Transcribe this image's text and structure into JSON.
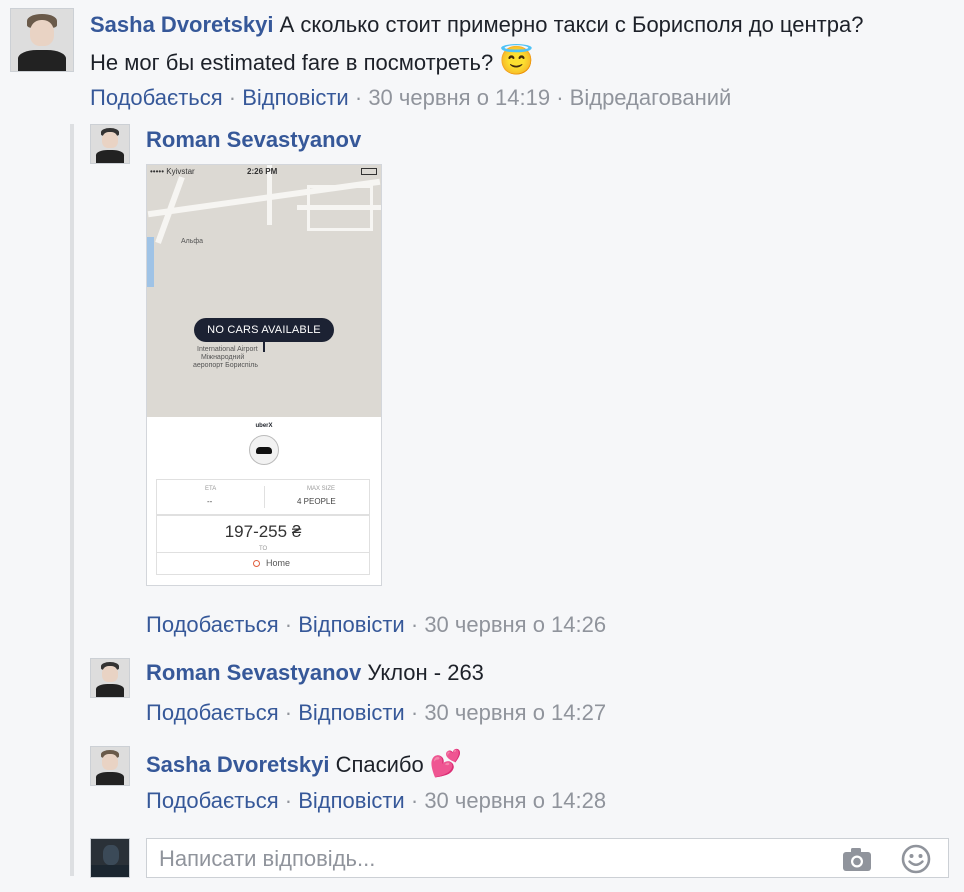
{
  "comments": [
    {
      "author": "Sasha Dvoretskyi",
      "text_line1": "А сколько стоит примерно такси с Борисполя до центра?",
      "text_line2": "Не мог бы estimated fare в посмотреть?",
      "emoji": "😇",
      "like": "Подобається",
      "reply": "Відповісти",
      "time": "30 червня о 14:19",
      "edited": "Відредагований"
    }
  ],
  "replies": [
    {
      "author": "Roman Sevastyanov",
      "text": "",
      "like": "Подобається",
      "reply": "Відповісти",
      "time": "30 червня о 14:26"
    },
    {
      "author": "Roman Sevastyanov",
      "text": "Уклон - 263",
      "like": "Подобається",
      "reply": "Відповісти",
      "time": "30 червня о 14:27"
    },
    {
      "author": "Sasha Dvoretskyi",
      "text": "Спасибо",
      "emoji": "💕",
      "like": "Подобається",
      "reply": "Відповісти",
      "time": "30 червня о 14:28"
    }
  ],
  "separator": "·",
  "screenshot": {
    "carrier": "••••• Kyivstar",
    "clock": "2:26 PM",
    "map_label_alfa": "Альфа",
    "map_label_airport1": "International Airport",
    "map_label_airport2": "Міжнародний",
    "map_label_airport3": "аеропорт Бориспіль",
    "no_cars": "NO CARS AVAILABLE",
    "product": "uberX",
    "eta_label": "ETA",
    "eta_value": "--",
    "max_size_label": "MAX SIZE",
    "max_size_value": "4 PEOPLE",
    "fare": "197-255 ₴",
    "to_label": "TO",
    "destination": "Home"
  },
  "reply_box": {
    "placeholder": "Написати відповідь...",
    "camera_icon": "camera-icon",
    "emoji_icon": "smiley-icon"
  }
}
